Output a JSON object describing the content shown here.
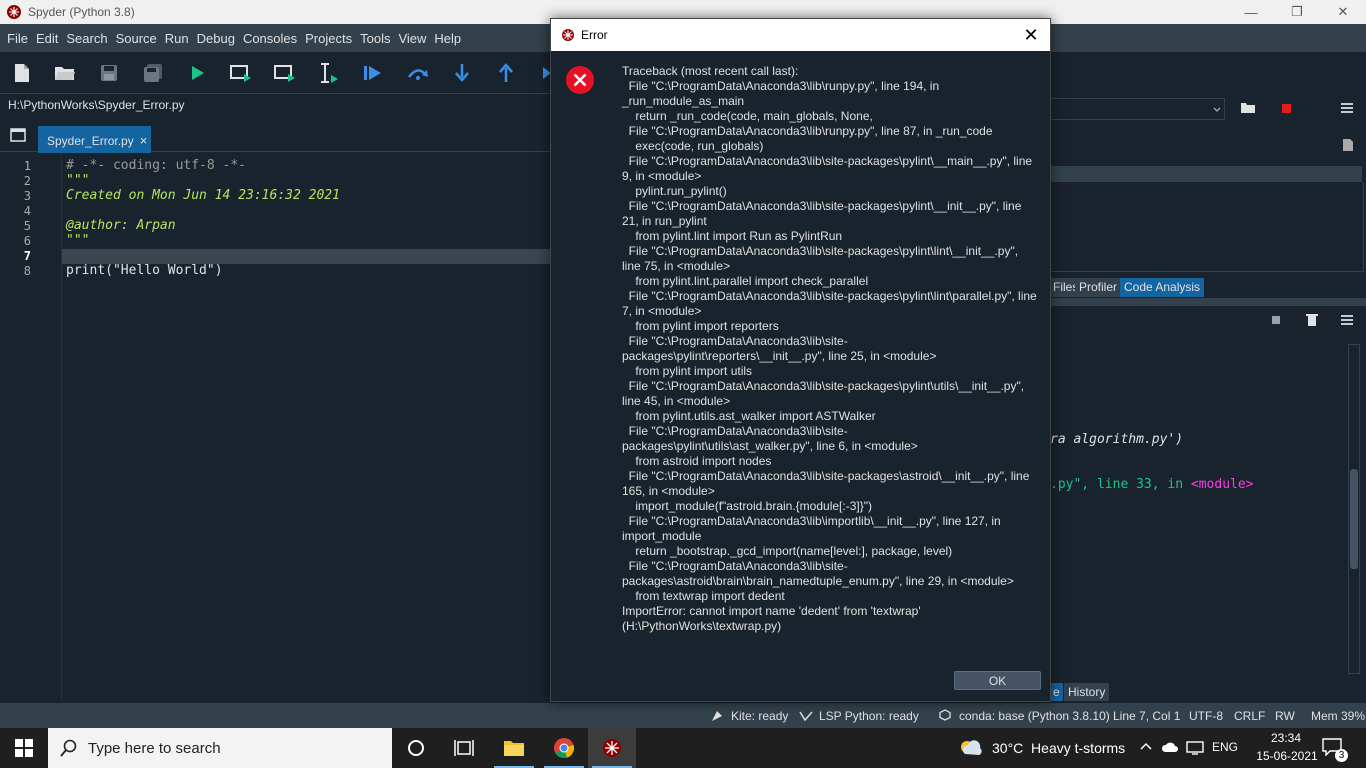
{
  "window": {
    "title": "Spyder (Python 3.8)",
    "minimize": "—",
    "maximize": "❐",
    "close": "✕"
  },
  "menu": [
    "File",
    "Edit",
    "Search",
    "Source",
    "Run",
    "Debug",
    "Consoles",
    "Projects",
    "Tools",
    "View",
    "Help"
  ],
  "path": "H:\\PythonWorks\\Spyder_Error.py",
  "editor": {
    "tab_label": "Spyder_Error.py",
    "tab_close": "×",
    "line_numbers": [
      "1",
      "2",
      "3",
      "4",
      "5",
      "6",
      "7",
      "8"
    ],
    "lines": [
      "# -*- coding: utf-8 -*-",
      "\"\"\"",
      "Created on Mon Jun 14 23:16:32 2021",
      "",
      "@author: Arpan",
      "\"\"\"",
      "",
      "print(\"Hello World\")"
    ]
  },
  "right_panes": {
    "tabs": [
      "Files",
      "Profiler",
      "Code Analysis"
    ],
    "console_fragment_1": "ra algorithm.py')",
    "console_fragment_2a": ".py\", line ",
    "console_fragment_2b": "33",
    "console_fragment_2c": ", in ",
    "console_fragment_2d": "<module>",
    "bottom_tabs": [
      "e",
      "History"
    ]
  },
  "status": {
    "kite": "Kite: ready",
    "lsp": "LSP Python: ready",
    "conda": "conda: base (Python 3.8.10)",
    "position": "Line 7, Col 1",
    "encoding": "UTF-8",
    "eol": "CRLF",
    "perm": "RW",
    "mem": "Mem 39%"
  },
  "dialog": {
    "title": "Error",
    "close": "✕",
    "message": "Traceback (most recent call last):\n  File \"C:\\ProgramData\\Anaconda3\\lib\\runpy.py\", line 194, in _run_module_as_main\n    return _run_code(code, main_globals, None,\n  File \"C:\\ProgramData\\Anaconda3\\lib\\runpy.py\", line 87, in _run_code\n    exec(code, run_globals)\n  File \"C:\\ProgramData\\Anaconda3\\lib\\site-packages\\pylint\\__main__.py\", line 9, in <module>\n    pylint.run_pylint()\n  File \"C:\\ProgramData\\Anaconda3\\lib\\site-packages\\pylint\\__init__.py\", line 21, in run_pylint\n    from pylint.lint import Run as PylintRun\n  File \"C:\\ProgramData\\Anaconda3\\lib\\site-packages\\pylint\\lint\\__init__.py\", line 75, in <module>\n    from pylint.lint.parallel import check_parallel\n  File \"C:\\ProgramData\\Anaconda3\\lib\\site-packages\\pylint\\lint\\parallel.py\", line 7, in <module>\n    from pylint import reporters\n  File \"C:\\ProgramData\\Anaconda3\\lib\\site-packages\\pylint\\reporters\\__init__.py\", line 25, in <module>\n    from pylint import utils\n  File \"C:\\ProgramData\\Anaconda3\\lib\\site-packages\\pylint\\utils\\__init__.py\", line 45, in <module>\n    from pylint.utils.ast_walker import ASTWalker\n  File \"C:\\ProgramData\\Anaconda3\\lib\\site-packages\\pylint\\utils\\ast_walker.py\", line 6, in <module>\n    from astroid import nodes\n  File \"C:\\ProgramData\\Anaconda3\\lib\\site-packages\\astroid\\__init__.py\", line 165, in <module>\n    import_module(f\"astroid.brain.{module[:-3]}\")\n  File \"C:\\ProgramData\\Anaconda3\\lib\\importlib\\__init__.py\", line 127, in import_module\n    return _bootstrap._gcd_import(name[level:], package, level)\n  File \"C:\\ProgramData\\Anaconda3\\lib\\site-packages\\astroid\\brain\\brain_namedtuple_enum.py\", line 29, in <module>\n    from textwrap import dedent\nImportError: cannot import name 'dedent' from 'textwrap' (H:\\PythonWorks\\textwrap.py)",
    "ok_label": "OK"
  },
  "taskbar": {
    "search_placeholder": "Type here to search",
    "weather": "30°C  Heavy t-storms",
    "lang": "ENG",
    "time": "23:34",
    "date": "15-06-2021",
    "notif_count": "3"
  },
  "colors": {
    "accent": "#1464a0",
    "background": "#19232d",
    "menubar": "#32414b"
  }
}
